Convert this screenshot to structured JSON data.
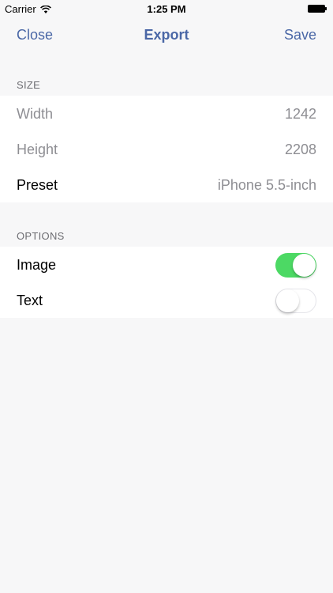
{
  "status_bar": {
    "carrier": "Carrier",
    "time": "1:25 PM",
    "wifi_icon": "wifi-icon",
    "battery_icon": "battery-icon"
  },
  "nav": {
    "left_label": "Close",
    "title": "Export",
    "right_label": "Save",
    "accent_color": "#4a67a6"
  },
  "size_section": {
    "header": "SIZE",
    "rows": [
      {
        "label": "Width",
        "value": "1242"
      },
      {
        "label": "Height",
        "value": "2208"
      },
      {
        "label": "Preset",
        "value": "iPhone 5.5-inch"
      }
    ]
  },
  "options_section": {
    "header": "OPTIONS",
    "rows": [
      {
        "label": "Image",
        "toggle": "on"
      },
      {
        "label": "Text",
        "toggle": "off"
      }
    ],
    "toggle_on_color": "#4cd964"
  }
}
